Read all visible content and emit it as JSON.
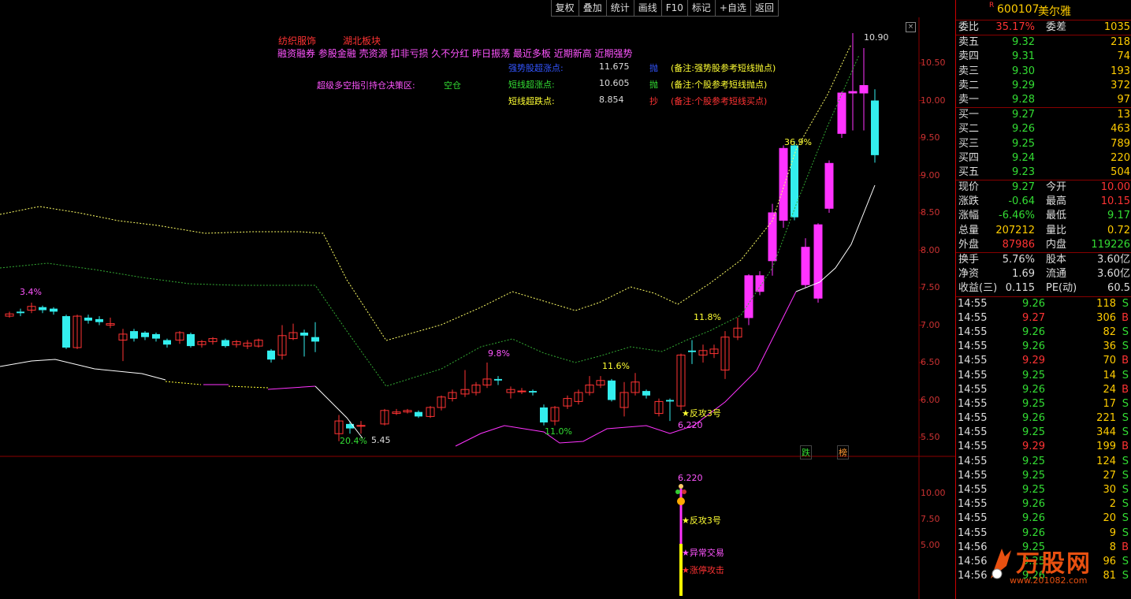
{
  "toolbar": {
    "buttons": [
      "复权",
      "叠加",
      "统计",
      "画线",
      "F10",
      "标记",
      "+自选",
      "返回"
    ]
  },
  "chart": {
    "close_symbol": "×",
    "sectors": [
      "纺织服饰",
      "湖北板块"
    ],
    "tags": "融资融券 参股金融 壳资源 扣非亏损 久不分红 昨日振荡 最近多板 近期新高 近期强势",
    "signals": [
      {
        "label": "强势股超涨点:",
        "value": "11.675",
        "action": "抛",
        "note": "(备注:强势股参考短线抛点)",
        "label_color": "#3355ff",
        "action_color": "#3355ff",
        "note_color": "#ffff33"
      },
      {
        "label": "短线超涨点:",
        "value": "10.605",
        "action": "抛",
        "note": "(备注:个股参考短线抛点)",
        "label_color": "#33dd33",
        "action_color": "#33dd33",
        "note_color": "#ffff33"
      },
      {
        "label": "短线超跌点:",
        "value": "8.854",
        "action": "抄",
        "note": "(备注:个股参考短线买点)",
        "label_color": "#ffff33",
        "action_color": "#ff3333",
        "note_color": "#ff3333"
      }
    ],
    "decision": {
      "label": "超级多空指引持仓决策区:",
      "value": "空仓"
    },
    "price_axis": [
      "10.50",
      "10.00",
      "9.50",
      "9.00",
      "8.50",
      "8.00",
      "7.50",
      "7.00",
      "6.50",
      "6.00",
      "5.50"
    ],
    "sub_axis": [
      "10.00",
      "7.50",
      "5.00"
    ],
    "annotations": {
      "high": "10.90",
      "low": "5.45",
      "pct_1": "3.4%",
      "pct_2": "20.4%",
      "pct_3": "9.8%",
      "pct_4": "11.0%",
      "pct_5": "11.6%",
      "pct_6": "11.8%",
      "pct_7": "36.9%",
      "fangong": "★反攻3号",
      "bottom_price": "6.220",
      "fall_badge": "跌",
      "list_badge": "榜"
    },
    "sub_annotations": {
      "price": "6.220",
      "fangong": "★反攻3号",
      "abnormal": "★异常交易",
      "limit_up": "★涨停攻击"
    },
    "colors": {
      "up": "#ff3333",
      "down": "#33eeee",
      "magenta": "#ff33ff",
      "bg": "#000000"
    }
  },
  "panel": {
    "code": "600107",
    "name": "美尔雅",
    "r_mark": "R",
    "weibi": {
      "label": "委比",
      "value": "35.17%",
      "label2": "委差",
      "value2": "1035"
    },
    "asks": [
      {
        "label": "卖五",
        "price": "9.32",
        "vol": "218"
      },
      {
        "label": "卖四",
        "price": "9.31",
        "vol": "74"
      },
      {
        "label": "卖三",
        "price": "9.30",
        "vol": "193"
      },
      {
        "label": "卖二",
        "price": "9.29",
        "vol": "372"
      },
      {
        "label": "卖一",
        "price": "9.28",
        "vol": "97"
      }
    ],
    "bids": [
      {
        "label": "买一",
        "price": "9.27",
        "vol": "13"
      },
      {
        "label": "买二",
        "price": "9.26",
        "vol": "463"
      },
      {
        "label": "买三",
        "price": "9.25",
        "vol": "789"
      },
      {
        "label": "买四",
        "price": "9.24",
        "vol": "220"
      },
      {
        "label": "买五",
        "price": "9.23",
        "vol": "504"
      }
    ],
    "quote": [
      {
        "l1": "现价",
        "v1": "9.27",
        "c1": "green",
        "l2": "今开",
        "v2": "10.00",
        "c2": "red"
      },
      {
        "l1": "涨跌",
        "v1": "-0.64",
        "c1": "green",
        "l2": "最高",
        "v2": "10.15",
        "c2": "red"
      },
      {
        "l1": "涨幅",
        "v1": "-6.46%",
        "c1": "green",
        "l2": "最低",
        "v2": "9.17",
        "c2": "green"
      },
      {
        "l1": "总量",
        "v1": "207212",
        "c1": "yellow",
        "l2": "量比",
        "v2": "0.72",
        "c2": "yellow"
      },
      {
        "l1": "外盘",
        "v1": "87986",
        "c1": "red",
        "l2": "内盘",
        "v2": "119226",
        "c2": "green"
      }
    ],
    "fund": [
      {
        "l1": "换手",
        "v1": "5.76%",
        "l2": "股本",
        "v2": "3.60亿"
      },
      {
        "l1": "净资",
        "v1": "1.69",
        "l2": "流通",
        "v2": "3.60亿"
      },
      {
        "l1": "收益(三)",
        "v1": "0.115",
        "l2": "PE(动)",
        "v2": "60.5"
      }
    ],
    "ticks": [
      {
        "t": "14:55",
        "p": "9.26",
        "v": "118",
        "s": "S"
      },
      {
        "t": "14:55",
        "p": "9.27",
        "v": "306",
        "s": "B"
      },
      {
        "t": "14:55",
        "p": "9.26",
        "v": "82",
        "s": "S"
      },
      {
        "t": "14:55",
        "p": "9.26",
        "v": "36",
        "s": "S"
      },
      {
        "t": "14:55",
        "p": "9.29",
        "v": "70",
        "s": "B"
      },
      {
        "t": "14:55",
        "p": "9.25",
        "v": "14",
        "s": "S"
      },
      {
        "t": "14:55",
        "p": "9.26",
        "v": "24",
        "s": "B"
      },
      {
        "t": "14:55",
        "p": "9.25",
        "v": "17",
        "s": "S"
      },
      {
        "t": "14:55",
        "p": "9.26",
        "v": "221",
        "s": "S"
      },
      {
        "t": "14:55",
        "p": "9.25",
        "v": "344",
        "s": "S"
      },
      {
        "t": "14:55",
        "p": "9.29",
        "v": "199",
        "s": "B"
      },
      {
        "t": "14:55",
        "p": "9.25",
        "v": "124",
        "s": "S"
      },
      {
        "t": "14:55",
        "p": "9.25",
        "v": "27",
        "s": "S"
      },
      {
        "t": "14:55",
        "p": "9.25",
        "v": "30",
        "s": "S"
      },
      {
        "t": "14:55",
        "p": "9.26",
        "v": "2",
        "s": "S"
      },
      {
        "t": "14:55",
        "p": "9.26",
        "v": "20",
        "s": "S"
      },
      {
        "t": "14:55",
        "p": "9.26",
        "v": "9",
        "s": "S"
      },
      {
        "t": "14:56",
        "p": "9.25",
        "v": "8",
        "s": "B"
      },
      {
        "t": "14:56",
        "p": "9.25",
        "v": "96",
        "s": "S"
      },
      {
        "t": "14:56",
        "p": "9.26",
        "v": "81",
        "s": "S"
      }
    ],
    "watermark": {
      "text": "万股网",
      "url": "www.201082.com"
    }
  }
}
